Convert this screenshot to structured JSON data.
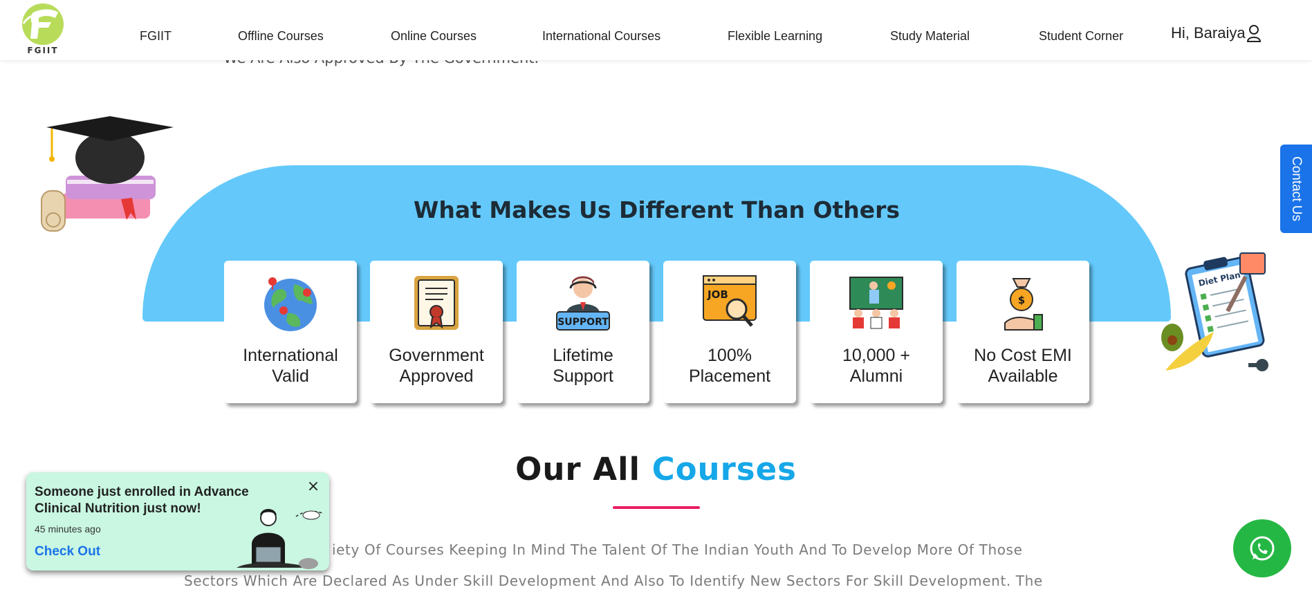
{
  "header": {
    "logo_text": "FGIIT",
    "nav": [
      "FGIIT",
      "Offline Courses",
      "Online Courses",
      "International Courses",
      "Flexible Learning",
      "Study Material",
      "Student Corner"
    ],
    "user_greeting": "Hi, Baraiya",
    "user_icon": "user-icon"
  },
  "intro_partial": "We Are Also Approved By The Government.",
  "features": {
    "title": "What Makes Us Different Than Others",
    "cards": [
      {
        "label": "International\nValid",
        "icon": "globe-icon"
      },
      {
        "label": "Government\nApproved",
        "icon": "certificate-icon"
      },
      {
        "label": "Lifetime\nSupport",
        "icon": "support-agent-icon"
      },
      {
        "label": "100%\nPlacement",
        "icon": "job-search-icon"
      },
      {
        "label": "10,000 +\nAlumni",
        "icon": "classroom-icon"
      },
      {
        "label": "No Cost EMI\nAvailable",
        "icon": "money-bag-icon"
      }
    ]
  },
  "contact_tab": "Contact Us",
  "courses": {
    "title_part1": "Our All",
    "title_part2": "Courses",
    "desc_line1": "iety Of Courses Keeping In Mind The Talent Of The Indian Youth And To Develop More Of Those",
    "desc_line2": "Sectors Which Are Declared As Under Skill Development And Also To Identify New Sectors For Skill Development. The"
  },
  "toast": {
    "message": "Someone just enrolled in Advance Clinical Nutrition just now!",
    "time": "45 minutes ago",
    "link": "Check Out",
    "close": "×"
  },
  "diet_plan_text": "Diet Plan",
  "colors": {
    "band": "#64c9fa",
    "accent": "#16a7e8",
    "underline": "#e91e63",
    "contact": "#1a73e8",
    "whatsapp": "#25b744",
    "toast_bg": "#c9f7e2"
  }
}
